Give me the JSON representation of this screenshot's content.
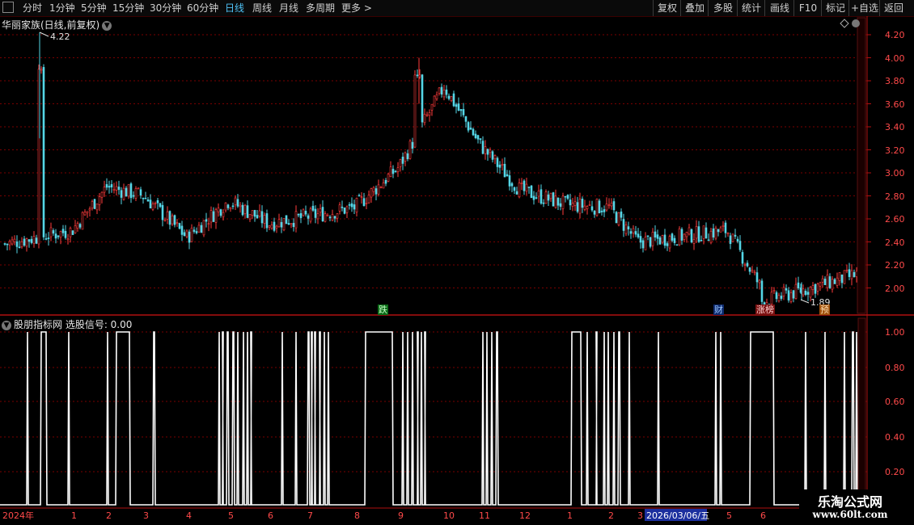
{
  "toolbar": {
    "left": [
      "分时",
      "1分钟",
      "5分钟",
      "15分钟",
      "30分钟",
      "60分钟",
      "日线",
      "周线",
      "月线",
      "多周期",
      "更多 >"
    ],
    "active": "日线",
    "right": [
      "复权",
      "叠加",
      "多股",
      "统计",
      "画线",
      "F10",
      "标记",
      "+自选",
      "返回"
    ]
  },
  "stock": {
    "title": "华丽家族(日线,前复权)"
  },
  "price_axis": {
    "labels": [
      "4.20",
      "4.00",
      "3.80",
      "3.60",
      "3.40",
      "3.20",
      "3.00",
      "2.80",
      "2.60",
      "2.40",
      "2.20",
      "2.00"
    ]
  },
  "price_marks": {
    "high": "4.22",
    "low": "1.89"
  },
  "events": {
    "e1": "跌",
    "e2": "财",
    "e3": "涨榜",
    "e4": "预"
  },
  "indicator": {
    "title": "股朋指标网 选股信号: 0.00",
    "axis": [
      "1.00",
      "0.80",
      "0.60",
      "0.40",
      "0.20"
    ]
  },
  "time_axis": {
    "labels": [
      "2024年",
      "1",
      "2",
      "3",
      "4",
      "5",
      "6",
      "7",
      "8",
      "9",
      "10",
      "11",
      "12",
      "1",
      "2",
      "3",
      "5",
      "6"
    ],
    "highlight": "2026/03/06/五"
  },
  "watermark": {
    "line1": "乐淘公式网",
    "line2": "www.60lt.com"
  },
  "colors": {
    "up": "#ff3c3c",
    "down": "#54d6e6",
    "grid": "#7a0000",
    "axis": "#b01010",
    "signal": "#ffffff",
    "active": "#4fc3f7"
  },
  "chart_data": {
    "type": "candlestick",
    "title": "华丽家族(日线,前复权)",
    "xlabel": "",
    "ylabel": "",
    "ylim": [
      1.85,
      4.28
    ],
    "anchors": [
      {
        "month": "2024年",
        "price": 2.38
      },
      {
        "month": "1",
        "price": 2.5
      },
      {
        "month": "2",
        "price": 2.88
      },
      {
        "month": "3",
        "price": 2.8
      },
      {
        "month": "4",
        "price": 2.44
      },
      {
        "month": "5",
        "price": 2.76
      },
      {
        "month": "6",
        "price": 2.56
      },
      {
        "month": "7",
        "price": 2.62
      },
      {
        "month": "8",
        "price": 2.7
      },
      {
        "month": "9",
        "price": 3.05
      },
      {
        "month": "10",
        "price": 3.75
      },
      {
        "month": "11",
        "price": 3.25
      },
      {
        "month": "12",
        "price": 2.85
      },
      {
        "month": "1",
        "price": 2.72
      },
      {
        "month": "2",
        "price": 2.7
      },
      {
        "month": "3",
        "price": 2.4
      },
      {
        "month": "5",
        "price": 2.5
      },
      {
        "month": "6",
        "price": 2.0
      }
    ],
    "high": 4.22,
    "low": 1.89,
    "signal": {
      "name": "选股信号",
      "ylim": [
        0,
        1.1
      ],
      "on_intervals": [
        [
          33,
          35
        ],
        [
          50,
          58
        ],
        [
          84,
          86
        ],
        [
          132,
          134
        ],
        [
          143,
          161
        ],
        [
          189,
          192
        ],
        [
          270,
          272
        ],
        [
          275,
          276
        ],
        [
          280,
          283
        ],
        [
          287,
          290
        ],
        [
          293,
          295
        ],
        [
          300,
          302
        ],
        [
          305,
          307
        ],
        [
          310,
          311
        ],
        [
          348,
          350
        ],
        [
          365,
          367
        ],
        [
          380,
          383
        ],
        [
          385,
          386
        ],
        [
          389,
          390
        ],
        [
          395,
          396
        ],
        [
          400,
          402
        ],
        [
          405,
          407
        ],
        [
          451,
          486
        ],
        [
          497,
          499
        ],
        [
          503,
          505
        ],
        [
          509,
          511
        ],
        [
          516,
          517
        ],
        [
          520,
          522
        ],
        [
          525,
          526
        ],
        [
          596,
          598
        ],
        [
          601,
          603
        ],
        [
          607,
          609
        ],
        [
          613,
          616
        ],
        [
          706,
          719
        ],
        [
          725,
          727
        ],
        [
          737,
          738
        ],
        [
          746,
          748
        ],
        [
          751,
          753
        ],
        [
          758,
          760
        ],
        [
          764,
          767
        ],
        [
          777,
          779
        ],
        [
          813,
          815
        ],
        [
          884,
          886
        ],
        [
          890,
          892
        ],
        [
          927,
          957
        ],
        [
          995,
          997
        ],
        [
          1019,
          1021
        ],
        [
          1043,
          1045
        ],
        [
          1053,
          1056
        ],
        [
          1058,
          1060
        ]
      ]
    }
  }
}
